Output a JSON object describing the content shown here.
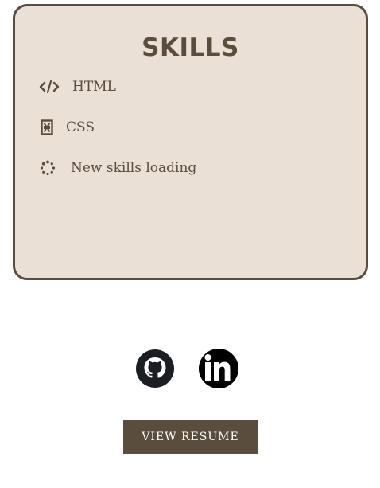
{
  "skills": {
    "title": "SKILLS",
    "items": [
      {
        "label": "HTML",
        "icon": "code-icon"
      },
      {
        "label": "CSS",
        "icon": "css-icon"
      },
      {
        "label": "New skills loading",
        "icon": "loading-spinner-icon"
      }
    ]
  },
  "social": {
    "links": [
      {
        "icon": "github-icon"
      },
      {
        "icon": "linkedin-icon"
      }
    ]
  },
  "resume_button": {
    "label": "VIEW RESUME"
  },
  "colors": {
    "card_background": "#eae0d6",
    "accent": "#5a4d3e",
    "button_text": "#ffffff"
  }
}
